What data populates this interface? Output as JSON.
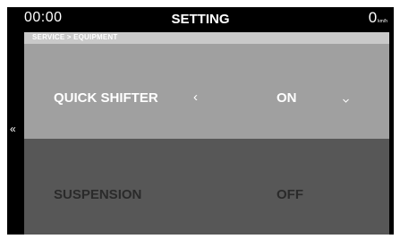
{
  "status": {
    "time": "00:00",
    "title": "SETTING",
    "speed_value": "0",
    "speed_unit": "km/h"
  },
  "breadcrumb": "SERVICE > EQUIPMENT",
  "back_label": "«",
  "rows": [
    {
      "label": "QUICK SHIFTER",
      "value": "ON",
      "selected": true
    },
    {
      "label": "SUSPENSION",
      "value": "OFF",
      "selected": false
    }
  ],
  "icons": {
    "back": "double-chevron-left-icon",
    "prev": "chevron-left-icon",
    "open": "chevron-down-icon"
  },
  "colors": {
    "background": "#000000",
    "breadcrumb_bar": "#c9c9c9",
    "selected_row": "#a0a0a0",
    "normal_row": "#575757",
    "normal_row_text": "#2a2a2a"
  }
}
